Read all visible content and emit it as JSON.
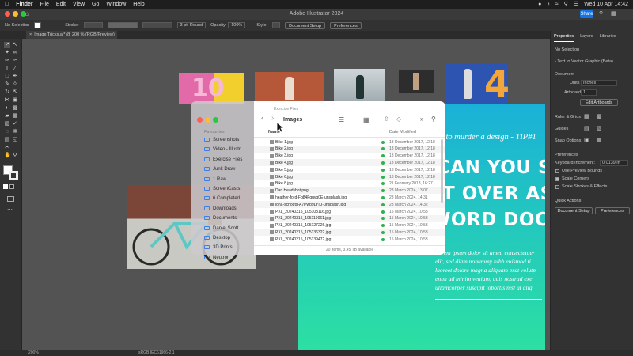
{
  "menubar": {
    "app": "Finder",
    "items": [
      "File",
      "Edit",
      "View",
      "Go",
      "Window",
      "Help"
    ],
    "clock": "Wed 10 Apr  14:42"
  },
  "titlebar": {
    "title": "Adobe Illustrator 2024",
    "share": "Share"
  },
  "controlbar": {
    "selection": "No Selection",
    "stroke_label": "Stroke:",
    "stroke_profile": "3 pt. Round",
    "opacity_label": "Opacity:",
    "opacity_value": "100%",
    "style_label": "Style:",
    "doc_setup": "Document Setup",
    "preferences": "Preferences"
  },
  "doc_tab": {
    "label": "Image Tricks.ai* @ 200 % (RGB/Preview)"
  },
  "panel": {
    "tabs": [
      "Properties",
      "Layers",
      "Libraries"
    ],
    "no_selection": "No Selection",
    "text_to_vector": "Text to Vector Graphic (Beta)",
    "document_heading": "Document",
    "units_label": "Units",
    "units_value": "Inches",
    "artboard_label": "Artboard",
    "artboard_value": "1",
    "edit_artboards": "Edit Artboards",
    "rulers_grids": "Ruler & Grids",
    "guides": "Guides",
    "snap_options": "Snap Options",
    "preferences_heading": "Preferences",
    "keyboard_increment_label": "Keyboard Increment:",
    "keyboard_increment_value": "0.0139 in",
    "use_preview_bounds": "Use Preview Bounds",
    "scale_corners": "Scale Corners",
    "scale_strokes": "Scale Strokes & Effects",
    "quick_actions": "Quick Actions",
    "doc_setup_btn": "Document Setup",
    "preferences_btn": "Preferences"
  },
  "finder": {
    "title": "Exercise Files",
    "folder": "Images",
    "sidebar_heading": "Favourites",
    "sidebar": [
      "Screenshots",
      "Video - Illustr...",
      "Exercise Files",
      "Junk Draw",
      "1 Raw",
      "ScreenCasts",
      "6 Completed...",
      "Downloads",
      "Documents",
      "Daniel Scott",
      "Desktop",
      "3D Prints",
      "Neutron"
    ],
    "col_name": "Name",
    "col_date": "Date Modified",
    "files": [
      {
        "name": "Bike 1.jpg",
        "date": "13 December 2017, 12:18"
      },
      {
        "name": "Bike 2.jpg",
        "date": "13 December 2017, 12:18"
      },
      {
        "name": "Bike 3.jpg",
        "date": "13 December 2017, 12:18"
      },
      {
        "name": "Bike 4.jpg",
        "date": "13 December 2017, 12:18"
      },
      {
        "name": "Bike 5.jpg",
        "date": "13 December 2017, 12:18"
      },
      {
        "name": "Bike 6.jpg",
        "date": "13 December 2017, 12:18"
      },
      {
        "name": "Bike 8.jpg",
        "date": "21 February 2018, 16:27"
      },
      {
        "name": "Dan Headshot.png",
        "date": "28 March 2024, 13:07"
      },
      {
        "name": "heather-ford-Fq84Fquvq0E-unsplash.jpg",
        "date": "28 March 2024, 14:31"
      },
      {
        "name": "lona-schodts-A7Pwp9LYIU-unsplash.jpg",
        "date": "28 March 2024, 14:32"
      },
      {
        "name": "PXL_20240315_105108116.jpg",
        "date": "15 March 2024, 10:53"
      },
      {
        "name": "PXL_20240315_105119061.jpg",
        "date": "15 March 2024, 10:53"
      },
      {
        "name": "PXL_20240315_105127226.jpg",
        "date": "15 March 2024, 10:53"
      },
      {
        "name": "PXL_20240315_105136322.jpg",
        "date": "15 March 2024, 10:53"
      },
      {
        "name": "PXL_20240315_105139472.jpg",
        "date": "15 March 2024, 10:53"
      }
    ],
    "status": "20 items, 3.45 TB available"
  },
  "poster": {
    "tip": "How to murder a design - TIP#1",
    "line1": "CAN YOU SEN",
    "line2": "IT OVER AS A",
    "line3": "WORD DOC.",
    "body": [
      "Lorem ipsum dolor sit amet, consectetuer",
      "elit, sed diam nonummy nibh euismod ti",
      "laoreet dolore magna aliquam erat volutp",
      "enim ad minim veniam, quis nostrud exe",
      "ullamcorper suscipit lobortis nisl ut aliq"
    ]
  },
  "statusbar": {
    "zoom": "200%",
    "profile": "sRGB IEC61966-2.1"
  },
  "colors": {
    "accent": "#1473e6",
    "finder_accent": "#3b80e8",
    "poster_top": "#1ab1d8",
    "poster_bottom": "#2de29f"
  }
}
